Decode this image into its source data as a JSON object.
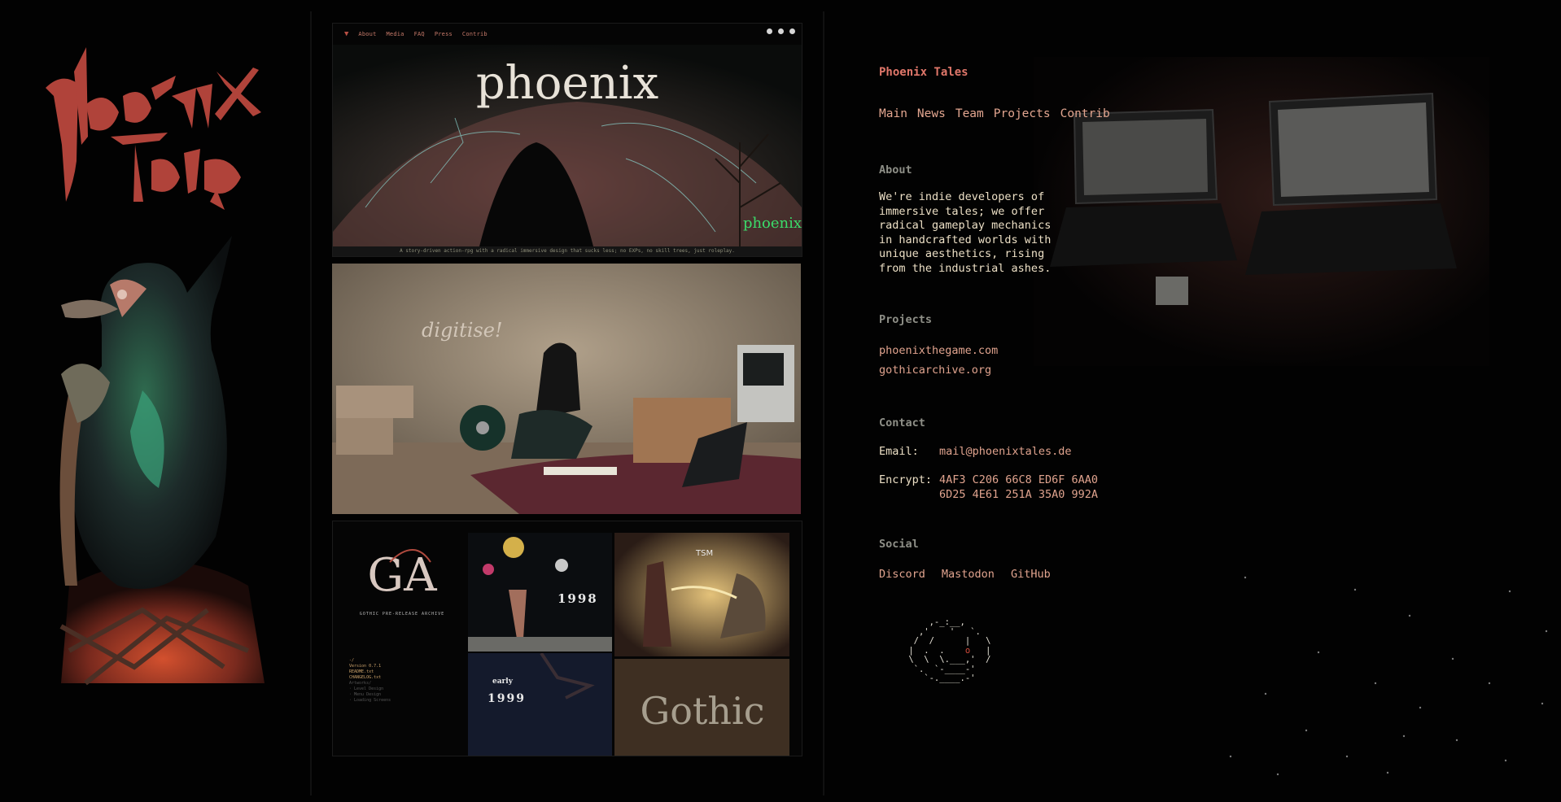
{
  "site": {
    "title": "Phoenix Tales",
    "nav": [
      "Main",
      "News",
      "Team",
      "Projects",
      "Contrib"
    ]
  },
  "about": {
    "heading": "About",
    "text": "We're indie developers of immersive tales; we offer radical gameplay mechanics in handcrafted worlds with unique aesthetics, rising from the industrial ashes."
  },
  "projects": {
    "heading": "Projects",
    "links": [
      "phoenixthegame.com",
      "gothicarchive.org"
    ]
  },
  "contact": {
    "heading": "Contact",
    "email_label": "Email:",
    "email": "mail@phoenixtales.de",
    "encrypt_label": "Encrypt:",
    "encrypt_line1": "4AF3 C206 66C8 ED6F 6AA0",
    "encrypt_line2": "6D25 4E61 251A 35A0 992A"
  },
  "social": {
    "heading": "Social",
    "links": [
      "Discord",
      "Mastodon",
      "GitHub"
    ]
  },
  "gallery": {
    "mini_nav": [
      "About",
      "Media",
      "FAQ",
      "Press",
      "Contrib"
    ],
    "banner_title": "phoenix",
    "banner_caption": "A story-driven action-rpg with a radical immersive design that sucks less; no EXPs, no skill trees, just roleplay.",
    "wall_text": "digitise!",
    "archive_title": "GOTHIC PRE-RELEASE ARCHIVE",
    "tile_year_1": "1998",
    "tile_year_2": "1999",
    "tile_early": "early",
    "tile_gothic": "Gothic",
    "version": "Version 0.7.1"
  },
  "colors": {
    "background": "#020202",
    "accent_red": "#e0776a",
    "link": "#e0a38e",
    "heading_grey": "#8e8f87",
    "body_text": "#ede0c6"
  },
  "icons": [
    "mastodon-icon",
    "discord-icon",
    "github-icon"
  ]
}
